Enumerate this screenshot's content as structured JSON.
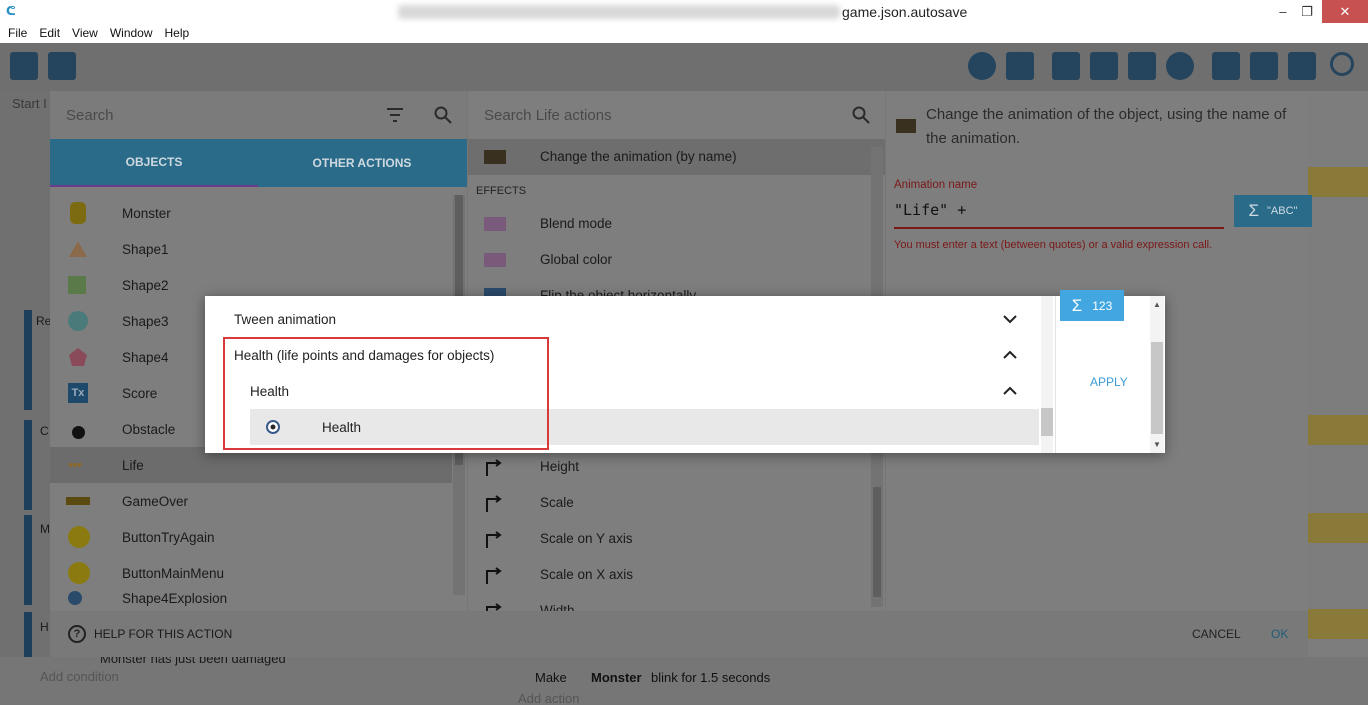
{
  "window": {
    "title_suffix": "game.json.autosave",
    "minimize": "–",
    "maximize": "❐",
    "close": "✕"
  },
  "menu": [
    "File",
    "Edit",
    "View",
    "Window",
    "Help"
  ],
  "background": {
    "start_tab": "Start I",
    "frag_re": "Re",
    "frag_c": "C",
    "frag_m": "M",
    "frag_h": "H",
    "add_condition": "Add condition",
    "add_action": "Add action",
    "event_text": "Monster has just been damaged",
    "blink_prefix": "Make",
    "blink_object": "Monster",
    "blink_suffix": "blink for 1.5 seconds"
  },
  "left": {
    "search_placeholder": "Search",
    "tabs": [
      "OBJECTS",
      "OTHER ACTIONS"
    ],
    "objects": [
      {
        "name": "Monster",
        "icon": "monster-icon"
      },
      {
        "name": "Shape1",
        "icon": "triangle-icon"
      },
      {
        "name": "Shape2",
        "icon": "square-icon"
      },
      {
        "name": "Shape3",
        "icon": "circle-icon"
      },
      {
        "name": "Shape4",
        "icon": "pentagon-icon"
      },
      {
        "name": "Score",
        "icon": "text-icon"
      },
      {
        "name": "Obstacle",
        "icon": "bomb-icon"
      },
      {
        "name": "Life",
        "icon": "hearts-icon"
      },
      {
        "name": "GameOver",
        "icon": "gameover-icon"
      },
      {
        "name": "ButtonTryAgain",
        "icon": "button-icon"
      },
      {
        "name": "ButtonMainMenu",
        "icon": "button-icon"
      },
      {
        "name": "Shape4Explosion",
        "icon": "explosion-icon"
      }
    ],
    "selected": "Life"
  },
  "middle": {
    "search_placeholder": "Search Life actions",
    "selected_action": "Change the animation (by name)",
    "section": "EFFECTS",
    "effects": [
      "Blend mode",
      "Global color",
      "Flip the object horizontally"
    ],
    "size_actions": [
      "Height",
      "Scale",
      "Scale on Y axis",
      "Scale on X axis",
      "Width"
    ]
  },
  "right": {
    "description": "Change the animation of the object, using the name of the animation.",
    "param_label": "Animation name",
    "param_value": "\"Life\" +",
    "param_error": "You must enter a text (between quotes) or a valid expression call.",
    "expr_button": "\"ABC\"",
    "sigma": "Σ"
  },
  "footer": {
    "help": "HELP FOR THIS ACTION",
    "cancel": "CANCEL",
    "ok": "OK"
  },
  "popup": {
    "rows": [
      {
        "label": "Tween animation",
        "level": 0,
        "expanded": false
      },
      {
        "label": "Health (life points and damages for objects)",
        "level": 0,
        "expanded": true
      },
      {
        "label": "Health",
        "level": 1,
        "expanded": true
      },
      {
        "label": "Health",
        "level": 2,
        "highlighted": true
      }
    ],
    "num_button": "123",
    "apply": "APPLY"
  }
}
